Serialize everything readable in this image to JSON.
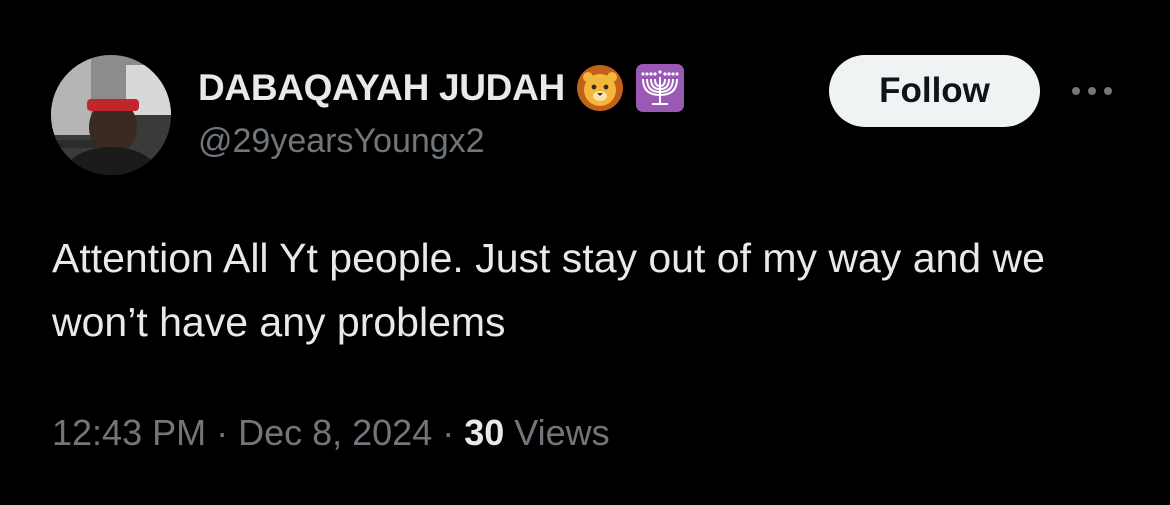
{
  "author": {
    "display_name": "DABAQAYAH JUDAH",
    "handle": "@29yearsYoungx2",
    "badges": [
      "lion-face-emoji",
      "menorah-emoji"
    ]
  },
  "follow_button": {
    "label": "Follow"
  },
  "more_button": {
    "icon": "more-horizontal-icon"
  },
  "tweet": {
    "text": "Attention All Yt people. Just stay out of my way and we won’t have any problems"
  },
  "meta": {
    "time": "12:43 PM",
    "separator": "·",
    "date": "Dec 8, 2024",
    "views_count": "30",
    "views_label": "Views"
  },
  "colors": {
    "background": "#000000",
    "primary_text": "#e7e9ea",
    "secondary_text": "#71767b",
    "follow_bg": "#eff3f4",
    "follow_text": "#0f1419",
    "menorah_badge_bg": "#9b59b6"
  }
}
